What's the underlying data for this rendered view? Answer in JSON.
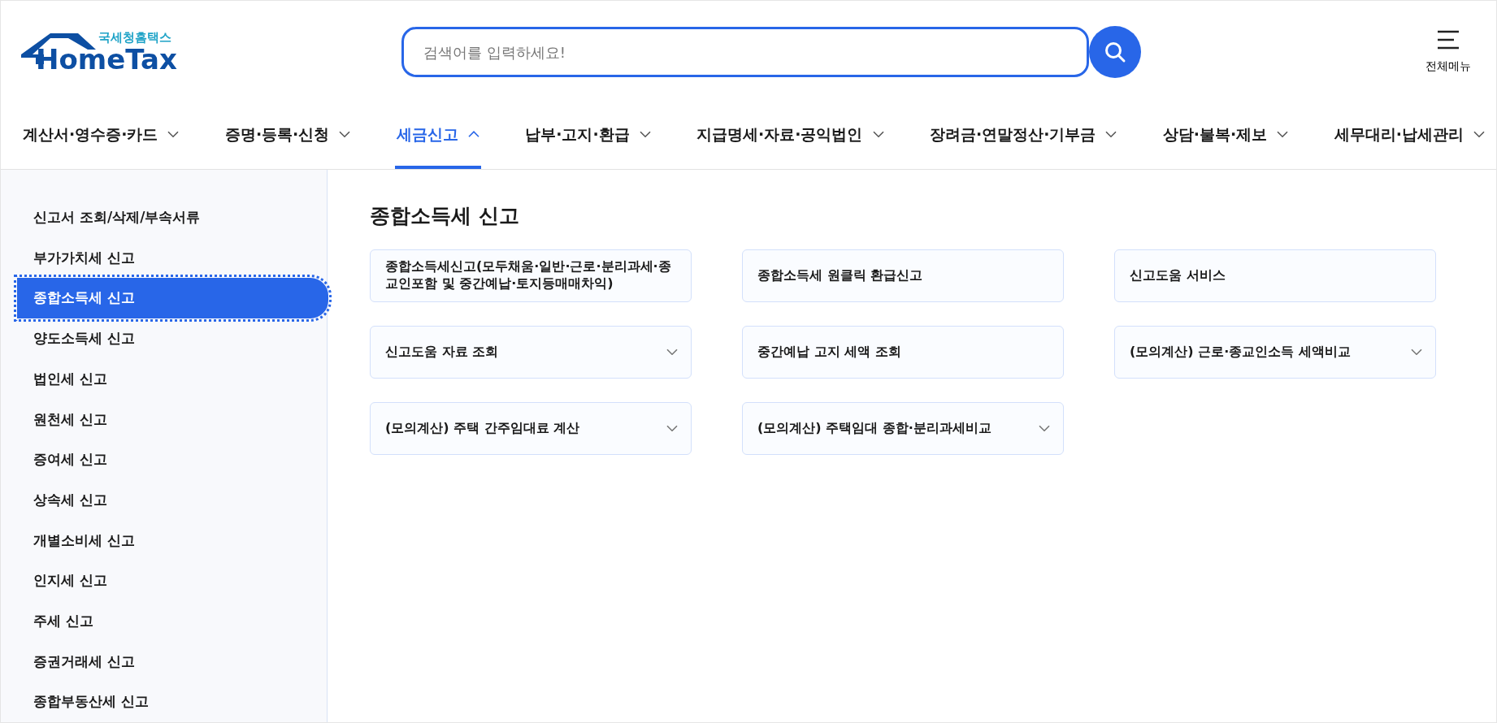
{
  "logo": {
    "subtitle": "국세청홈택스",
    "title": "HomeTax"
  },
  "search": {
    "placeholder": "검색어를 입력하세요!"
  },
  "all_menu": {
    "label": "전체메뉴"
  },
  "nav": [
    {
      "label": "계산서·영수증·카드",
      "selected": false,
      "expanded": false
    },
    {
      "label": "증명·등록·신청",
      "selected": false,
      "expanded": false
    },
    {
      "label": "세금신고",
      "selected": true,
      "expanded": true
    },
    {
      "label": "납부·고지·환급",
      "selected": false,
      "expanded": false
    },
    {
      "label": "지급명세·자료·공익법인",
      "selected": false,
      "expanded": false
    },
    {
      "label": "장려금·연말정산·기부금",
      "selected": false,
      "expanded": false
    },
    {
      "label": "상담·불복·제보",
      "selected": false,
      "expanded": false
    },
    {
      "label": "세무대리·납세관리",
      "selected": false,
      "expanded": false
    }
  ],
  "sidebar": {
    "items": [
      {
        "label": "신고서 조회/삭제/부속서류",
        "selected": false
      },
      {
        "label": "부가가치세 신고",
        "selected": false
      },
      {
        "label": "종합소득세 신고",
        "selected": true
      },
      {
        "label": "양도소득세 신고",
        "selected": false
      },
      {
        "label": "법인세 신고",
        "selected": false
      },
      {
        "label": "원천세 신고",
        "selected": false
      },
      {
        "label": "증여세 신고",
        "selected": false
      },
      {
        "label": "상속세 신고",
        "selected": false
      },
      {
        "label": "개별소비세 신고",
        "selected": false
      },
      {
        "label": "인지세 신고",
        "selected": false
      },
      {
        "label": "주세 신고",
        "selected": false
      },
      {
        "label": "증권거래세 신고",
        "selected": false
      },
      {
        "label": "종합부동산세 신고",
        "selected": false
      }
    ]
  },
  "main": {
    "title": "종합소득세 신고",
    "cards": [
      {
        "label": "종합소득세신고(모두채움·일반·근로·분리과세·종교인포함 및 중간예납·토지등매매차익)",
        "expandable": false
      },
      {
        "label": "종합소득세 원클릭 환급신고",
        "expandable": false
      },
      {
        "label": "신고도움 서비스",
        "expandable": false
      },
      {
        "label": "신고도움 자료 조회",
        "expandable": true
      },
      {
        "label": "중간예납 고지 세액 조회",
        "expandable": false
      },
      {
        "label": "(모의계산) 근로·종교인소득 세액비교",
        "expandable": true
      },
      {
        "label": "(모의계산) 주택 간주임대료 계산",
        "expandable": true
      },
      {
        "label": "(모의계산) 주택임대 종합·분리과세비교",
        "expandable": true
      }
    ]
  }
}
